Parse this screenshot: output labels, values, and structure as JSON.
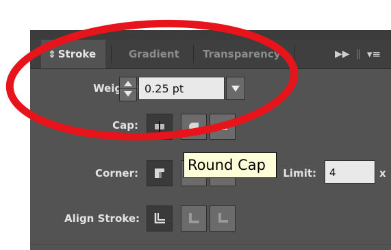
{
  "tabs": [
    {
      "label": "Stroke",
      "icon": "collapse-toggle-icon"
    },
    {
      "label": "Gradient"
    },
    {
      "label": "Transparency"
    }
  ],
  "panel_controls": {
    "forward_icon": "double-chevron-icon",
    "menu_icon": "panel-menu-icon"
  },
  "weight": {
    "label": "Weight:",
    "value": "0.25 pt"
  },
  "cap": {
    "label": "Cap:",
    "options": [
      "Butt Cap",
      "Round Cap",
      "Projecting Cap"
    ],
    "selected": "Butt Cap"
  },
  "corner": {
    "label": "Corner:",
    "options": [
      "Miter Join",
      "Round Join",
      "Bevel Join"
    ],
    "selected": "Miter Join"
  },
  "limit": {
    "label": "Limit:",
    "value": "4",
    "suffix": "x"
  },
  "align_stroke": {
    "label": "Align Stroke:",
    "options": [
      "Align Stroke to Center",
      "Align Stroke to Inside",
      "Align Stroke to Outside"
    ],
    "selected": "Align Stroke to Center"
  },
  "tooltip": {
    "text": "Round Cap"
  },
  "annotation": {
    "color": "#e8141b",
    "shape": "ellipse"
  },
  "colors": {
    "panel": "#535353",
    "tab_bar": "#3f3f3f",
    "field": "#e9e9e9",
    "tooltip_bg": "#fefed8"
  }
}
